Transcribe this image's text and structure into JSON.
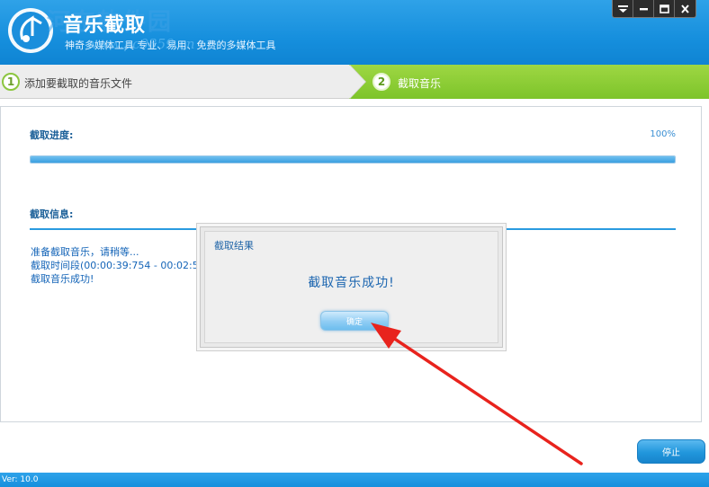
{
  "app": {
    "title": "音乐截取",
    "subtitle": "神奇多媒体工具 专业、易用、免费的多媒体工具",
    "watermark": "河东软件园",
    "watermark_url": "www.pc0359.cn"
  },
  "window_controls": [
    "menu-icon",
    "minimize-icon",
    "maximize-icon",
    "close-icon"
  ],
  "steps": [
    {
      "number": "1",
      "label": "添加要截取的音乐文件",
      "active": false
    },
    {
      "number": "2",
      "label": "截取音乐",
      "active": true
    }
  ],
  "progress": {
    "label": "截取进度:",
    "percent_text": "100%",
    "value": 1.0
  },
  "info": {
    "label": "截取信息:",
    "log": [
      "准备截取音乐，请稍等...",
      "截取时间段(00:00:39:754 - 00:02:5",
      "截取音乐成功!"
    ]
  },
  "dialog": {
    "title": "截取结果",
    "message": "截取音乐成功!",
    "ok_label": "确定"
  },
  "footer": {
    "stop_label": "停止",
    "version": "Ver: 10.0"
  },
  "colors": {
    "header_blue": "#168fdd",
    "step_green": "#7dc42a",
    "text_blue": "#1565b8",
    "annotation_red": "#e8231d"
  }
}
